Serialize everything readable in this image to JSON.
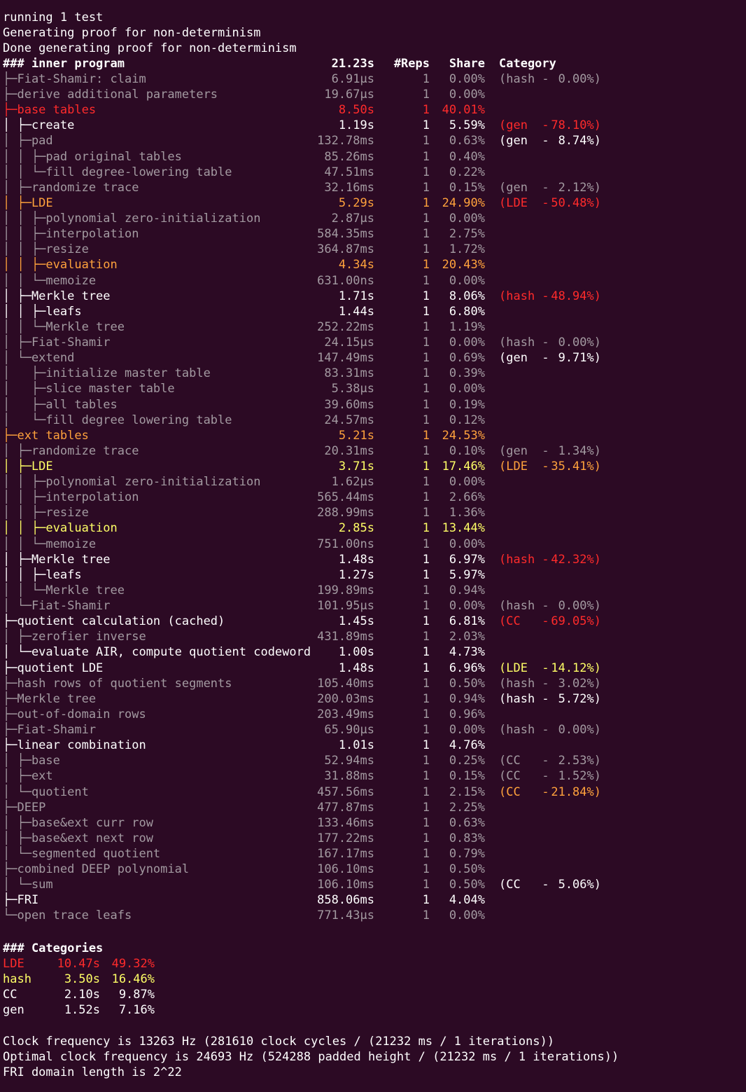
{
  "preamble": [
    "running 1 test",
    "Generating proof for non-determinism",
    "Done generating proof for non-determinism"
  ],
  "header": {
    "title": "### inner program",
    "time": "21.23s",
    "reps": "#Reps",
    "share": "Share",
    "category": "Category"
  },
  "rows": [
    {
      "tree": "├─Fiat-Shamir: claim",
      "time": "6.91µs",
      "reps": "1",
      "share": "0.00%",
      "catn": "(hash -",
      "catp": "0.00%)",
      "color": "dim",
      "catcolor": "dim"
    },
    {
      "tree": "├─derive additional parameters",
      "time": "19.67µs",
      "reps": "1",
      "share": "0.00%",
      "catn": "",
      "catp": "",
      "color": "dim",
      "catcolor": "dim"
    },
    {
      "tree": "├─base tables",
      "time": "8.50s",
      "reps": "1",
      "share": "40.01%",
      "catn": "",
      "catp": "",
      "color": "red",
      "catcolor": "dim"
    },
    {
      "tree": "│ ├─create",
      "time": "1.19s",
      "reps": "1",
      "share": "5.59%",
      "catn": "(gen  -",
      "catp": "78.10%)",
      "color": "norm",
      "catcolor": "red"
    },
    {
      "tree": "│ ├─pad",
      "time": "132.78ms",
      "reps": "1",
      "share": "0.63%",
      "catn": "(gen  -",
      "catp": "8.74%)",
      "color": "dim",
      "catcolor": "norm"
    },
    {
      "tree": "│ │ ├─pad original tables",
      "time": "85.26ms",
      "reps": "1",
      "share": "0.40%",
      "catn": "",
      "catp": "",
      "color": "dim",
      "catcolor": "dim"
    },
    {
      "tree": "│ │ └─fill degree-lowering table",
      "time": "47.51ms",
      "reps": "1",
      "share": "0.22%",
      "catn": "",
      "catp": "",
      "color": "dim",
      "catcolor": "dim"
    },
    {
      "tree": "│ ├─randomize trace",
      "time": "32.16ms",
      "reps": "1",
      "share": "0.15%",
      "catn": "(gen  -",
      "catp": "2.12%)",
      "color": "dim",
      "catcolor": "dim"
    },
    {
      "tree": "│ ├─LDE",
      "time": "5.29s",
      "reps": "1",
      "share": "24.90%",
      "catn": "(LDE  -",
      "catp": "50.48%)",
      "color": "orange",
      "catcolor": "red"
    },
    {
      "tree": "│ │ ├─polynomial zero-initialization",
      "time": "2.87µs",
      "reps": "1",
      "share": "0.00%",
      "catn": "",
      "catp": "",
      "color": "dim",
      "catcolor": "dim"
    },
    {
      "tree": "│ │ ├─interpolation",
      "time": "584.35ms",
      "reps": "1",
      "share": "2.75%",
      "catn": "",
      "catp": "",
      "color": "dim",
      "catcolor": "dim"
    },
    {
      "tree": "│ │ ├─resize",
      "time": "364.87ms",
      "reps": "1",
      "share": "1.72%",
      "catn": "",
      "catp": "",
      "color": "dim",
      "catcolor": "dim"
    },
    {
      "tree": "│ │ ├─evaluation",
      "time": "4.34s",
      "reps": "1",
      "share": "20.43%",
      "catn": "",
      "catp": "",
      "color": "orange",
      "catcolor": "dim"
    },
    {
      "tree": "│ │ └─memoize",
      "time": "631.00ns",
      "reps": "1",
      "share": "0.00%",
      "catn": "",
      "catp": "",
      "color": "dim",
      "catcolor": "dim"
    },
    {
      "tree": "│ ├─Merkle tree",
      "time": "1.71s",
      "reps": "1",
      "share": "8.06%",
      "catn": "(hash -",
      "catp": "48.94%)",
      "color": "norm",
      "catcolor": "red"
    },
    {
      "tree": "│ │ ├─leafs",
      "time": "1.44s",
      "reps": "1",
      "share": "6.80%",
      "catn": "",
      "catp": "",
      "color": "norm",
      "catcolor": "dim"
    },
    {
      "tree": "│ │ └─Merkle tree",
      "time": "252.22ms",
      "reps": "1",
      "share": "1.19%",
      "catn": "",
      "catp": "",
      "color": "dim",
      "catcolor": "dim"
    },
    {
      "tree": "│ ├─Fiat-Shamir",
      "time": "24.15µs",
      "reps": "1",
      "share": "0.00%",
      "catn": "(hash -",
      "catp": "0.00%)",
      "color": "dim",
      "catcolor": "dim"
    },
    {
      "tree": "│ └─extend",
      "time": "147.49ms",
      "reps": "1",
      "share": "0.69%",
      "catn": "(gen  -",
      "catp": "9.71%)",
      "color": "dim",
      "catcolor": "norm"
    },
    {
      "tree": "│   ├─initialize master table",
      "time": "83.31ms",
      "reps": "1",
      "share": "0.39%",
      "catn": "",
      "catp": "",
      "color": "dim",
      "catcolor": "dim"
    },
    {
      "tree": "│   ├─slice master table",
      "time": "5.38µs",
      "reps": "1",
      "share": "0.00%",
      "catn": "",
      "catp": "",
      "color": "dim",
      "catcolor": "dim"
    },
    {
      "tree": "│   ├─all tables",
      "time": "39.60ms",
      "reps": "1",
      "share": "0.19%",
      "catn": "",
      "catp": "",
      "color": "dim",
      "catcolor": "dim"
    },
    {
      "tree": "│   └─fill degree lowering table",
      "time": "24.57ms",
      "reps": "1",
      "share": "0.12%",
      "catn": "",
      "catp": "",
      "color": "dim",
      "catcolor": "dim"
    },
    {
      "tree": "├─ext tables",
      "time": "5.21s",
      "reps": "1",
      "share": "24.53%",
      "catn": "",
      "catp": "",
      "color": "orange",
      "catcolor": "dim"
    },
    {
      "tree": "│ ├─randomize trace",
      "time": "20.31ms",
      "reps": "1",
      "share": "0.10%",
      "catn": "(gen  -",
      "catp": "1.34%)",
      "color": "dim",
      "catcolor": "dim"
    },
    {
      "tree": "│ ├─LDE",
      "time": "3.71s",
      "reps": "1",
      "share": "17.46%",
      "catn": "(LDE  -",
      "catp": "35.41%)",
      "color": "yellow",
      "catcolor": "orange"
    },
    {
      "tree": "│ │ ├─polynomial zero-initialization",
      "time": "1.62µs",
      "reps": "1",
      "share": "0.00%",
      "catn": "",
      "catp": "",
      "color": "dim",
      "catcolor": "dim"
    },
    {
      "tree": "│ │ ├─interpolation",
      "time": "565.44ms",
      "reps": "1",
      "share": "2.66%",
      "catn": "",
      "catp": "",
      "color": "dim",
      "catcolor": "dim"
    },
    {
      "tree": "│ │ ├─resize",
      "time": "288.99ms",
      "reps": "1",
      "share": "1.36%",
      "catn": "",
      "catp": "",
      "color": "dim",
      "catcolor": "dim"
    },
    {
      "tree": "│ │ ├─evaluation",
      "time": "2.85s",
      "reps": "1",
      "share": "13.44%",
      "catn": "",
      "catp": "",
      "color": "yellow",
      "catcolor": "dim"
    },
    {
      "tree": "│ │ └─memoize",
      "time": "751.00ns",
      "reps": "1",
      "share": "0.00%",
      "catn": "",
      "catp": "",
      "color": "dim",
      "catcolor": "dim"
    },
    {
      "tree": "│ ├─Merkle tree",
      "time": "1.48s",
      "reps": "1",
      "share": "6.97%",
      "catn": "(hash -",
      "catp": "42.32%)",
      "color": "norm",
      "catcolor": "red"
    },
    {
      "tree": "│ │ ├─leafs",
      "time": "1.27s",
      "reps": "1",
      "share": "5.97%",
      "catn": "",
      "catp": "",
      "color": "norm",
      "catcolor": "dim"
    },
    {
      "tree": "│ │ └─Merkle tree",
      "time": "199.89ms",
      "reps": "1",
      "share": "0.94%",
      "catn": "",
      "catp": "",
      "color": "dim",
      "catcolor": "dim"
    },
    {
      "tree": "│ └─Fiat-Shamir",
      "time": "101.95µs",
      "reps": "1",
      "share": "0.00%",
      "catn": "(hash -",
      "catp": "0.00%)",
      "color": "dim",
      "catcolor": "dim"
    },
    {
      "tree": "├─quotient calculation (cached)",
      "time": "1.45s",
      "reps": "1",
      "share": "6.81%",
      "catn": "(CC   -",
      "catp": "69.05%)",
      "color": "norm",
      "catcolor": "red"
    },
    {
      "tree": "│ ├─zerofier inverse",
      "time": "431.89ms",
      "reps": "1",
      "share": "2.03%",
      "catn": "",
      "catp": "",
      "color": "dim",
      "catcolor": "dim"
    },
    {
      "tree": "│ └─evaluate AIR, compute quotient codeword",
      "time": "1.00s",
      "reps": "1",
      "share": "4.73%",
      "catn": "",
      "catp": "",
      "color": "norm",
      "catcolor": "dim"
    },
    {
      "tree": "├─quotient LDE",
      "time": "1.48s",
      "reps": "1",
      "share": "6.96%",
      "catn": "(LDE  -",
      "catp": "14.12%)",
      "color": "norm",
      "catcolor": "yellow"
    },
    {
      "tree": "├─hash rows of quotient segments",
      "time": "105.40ms",
      "reps": "1",
      "share": "0.50%",
      "catn": "(hash -",
      "catp": "3.02%)",
      "color": "dim",
      "catcolor": "dim"
    },
    {
      "tree": "├─Merkle tree",
      "time": "200.03ms",
      "reps": "1",
      "share": "0.94%",
      "catn": "(hash -",
      "catp": "5.72%)",
      "color": "dim",
      "catcolor": "norm"
    },
    {
      "tree": "├─out-of-domain rows",
      "time": "203.49ms",
      "reps": "1",
      "share": "0.96%",
      "catn": "",
      "catp": "",
      "color": "dim",
      "catcolor": "dim"
    },
    {
      "tree": "├─Fiat-Shamir",
      "time": "65.90µs",
      "reps": "1",
      "share": "0.00%",
      "catn": "(hash -",
      "catp": "0.00%)",
      "color": "dim",
      "catcolor": "dim"
    },
    {
      "tree": "├─linear combination",
      "time": "1.01s",
      "reps": "1",
      "share": "4.76%",
      "catn": "",
      "catp": "",
      "color": "norm",
      "catcolor": "dim"
    },
    {
      "tree": "│ ├─base",
      "time": "52.94ms",
      "reps": "1",
      "share": "0.25%",
      "catn": "(CC   -",
      "catp": "2.53%)",
      "color": "dim",
      "catcolor": "dim"
    },
    {
      "tree": "│ ├─ext",
      "time": "31.88ms",
      "reps": "1",
      "share": "0.15%",
      "catn": "(CC   -",
      "catp": "1.52%)",
      "color": "dim",
      "catcolor": "dim"
    },
    {
      "tree": "│ └─quotient",
      "time": "457.56ms",
      "reps": "1",
      "share": "2.15%",
      "catn": "(CC   -",
      "catp": "21.84%)",
      "color": "dim",
      "catcolor": "orange"
    },
    {
      "tree": "├─DEEP",
      "time": "477.87ms",
      "reps": "1",
      "share": "2.25%",
      "catn": "",
      "catp": "",
      "color": "dim",
      "catcolor": "dim"
    },
    {
      "tree": "│ ├─base&ext curr row",
      "time": "133.46ms",
      "reps": "1",
      "share": "0.63%",
      "catn": "",
      "catp": "",
      "color": "dim",
      "catcolor": "dim"
    },
    {
      "tree": "│ ├─base&ext next row",
      "time": "177.22ms",
      "reps": "1",
      "share": "0.83%",
      "catn": "",
      "catp": "",
      "color": "dim",
      "catcolor": "dim"
    },
    {
      "tree": "│ └─segmented quotient",
      "time": "167.17ms",
      "reps": "1",
      "share": "0.79%",
      "catn": "",
      "catp": "",
      "color": "dim",
      "catcolor": "dim"
    },
    {
      "tree": "├─combined DEEP polynomial",
      "time": "106.10ms",
      "reps": "1",
      "share": "0.50%",
      "catn": "",
      "catp": "",
      "color": "dim",
      "catcolor": "dim"
    },
    {
      "tree": "│ └─sum",
      "time": "106.10ms",
      "reps": "1",
      "share": "0.50%",
      "catn": "(CC   -",
      "catp": "5.06%)",
      "color": "dim",
      "catcolor": "norm"
    },
    {
      "tree": "├─FRI",
      "time": "858.06ms",
      "reps": "1",
      "share": "4.04%",
      "catn": "",
      "catp": "",
      "color": "norm",
      "catcolor": "dim"
    },
    {
      "tree": "└─open trace leafs",
      "time": "771.43µs",
      "reps": "1",
      "share": "0.00%",
      "catn": "",
      "catp": "",
      "color": "dim",
      "catcolor": "dim"
    }
  ],
  "categories": {
    "title": "### Categories",
    "items": [
      {
        "name": "LDE",
        "time": "10.47s",
        "share": "49.32%",
        "color": "red"
      },
      {
        "name": "hash",
        "time": "3.50s",
        "share": "16.46%",
        "color": "yellow"
      },
      {
        "name": "CC",
        "time": "2.10s",
        "share": "9.87%",
        "color": "norm"
      },
      {
        "name": "gen",
        "time": "1.52s",
        "share": "7.16%",
        "color": "norm"
      }
    ]
  },
  "footer": [
    "Clock frequency is 13263 Hz (281610 clock cycles / (21232 ms / 1 iterations))",
    "Optimal clock frequency is 24693 Hz (524288 padded height / (21232 ms / 1 iterations))",
    "FRI domain length is 2^22"
  ],
  "colors": {
    "background": "#2c0a24",
    "text": "#ffffff",
    "dim": "#a39aa1",
    "red": "#ff2b2b",
    "orange": "#ffa23c",
    "yellow": "#ffff66"
  }
}
